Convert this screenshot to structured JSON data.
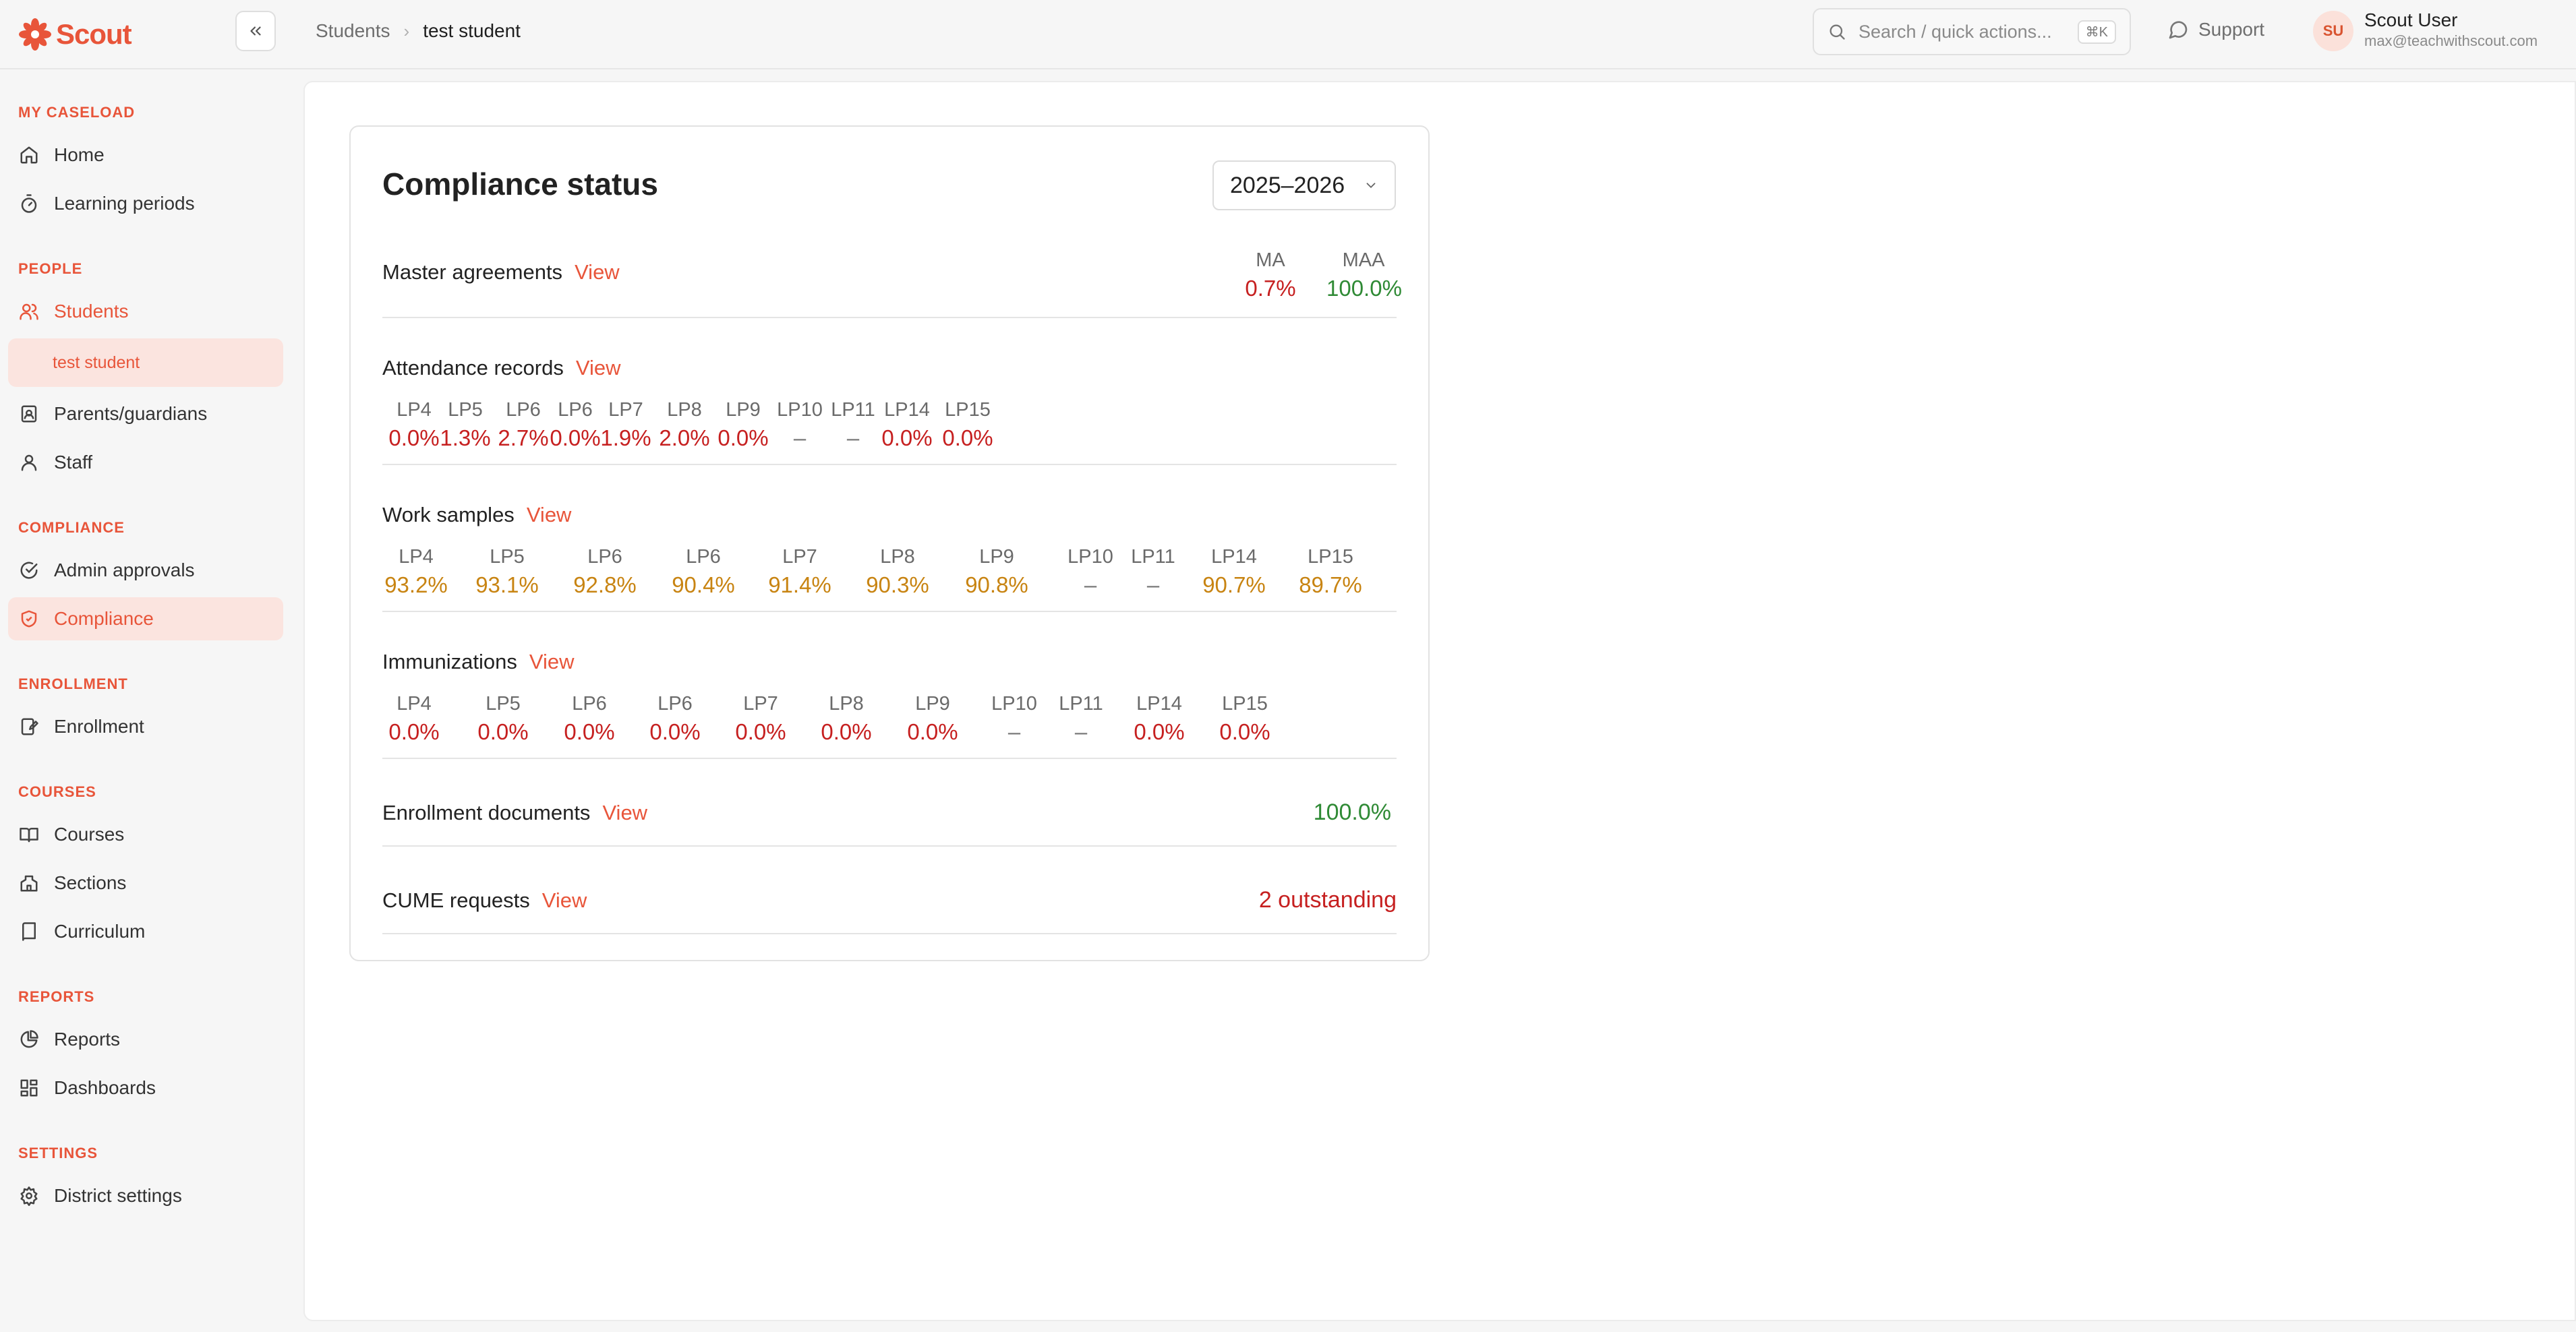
{
  "app": {
    "name": "Scout",
    "brand_color": "#e8553a"
  },
  "breadcrumb": {
    "parent": "Students",
    "current": "test student"
  },
  "search": {
    "placeholder": "Search / quick actions...",
    "shortcut": "⌘K"
  },
  "support": {
    "label": "Support"
  },
  "user": {
    "initials": "SU",
    "name": "Scout User",
    "email": "max@teachwithscout.com"
  },
  "sidebar": {
    "sections": {
      "caseload": "MY CASELOAD",
      "people": "PEOPLE",
      "compliance": "COMPLIANCE",
      "enrollment": "ENROLLMENT",
      "courses": "COURSES",
      "reports": "REPORTS",
      "settings": "SETTINGS"
    },
    "items": {
      "home": "Home",
      "learning_periods": "Learning periods",
      "students": "Students",
      "test_student": "test student",
      "parents": "Parents/guardians",
      "staff": "Staff",
      "admin_approvals": "Admin approvals",
      "compliance": "Compliance",
      "enrollment": "Enrollment",
      "courses": "Courses",
      "sections": "Sections",
      "curriculum": "Curriculum",
      "reports": "Reports",
      "dashboards": "Dashboards",
      "district_settings": "District settings"
    }
  },
  "compliance": {
    "title": "Compliance status",
    "year": "2025–2026",
    "view_label": "View",
    "master_agreements": {
      "label": "Master agreements",
      "cols": [
        {
          "h": "MA",
          "v": "0.7%",
          "status": "red"
        },
        {
          "h": "MAA",
          "v": "100.0%",
          "status": "green"
        }
      ]
    },
    "attendance": {
      "label": "Attendance records",
      "cols": [
        {
          "h": "LP4",
          "v": "0.0%"
        },
        {
          "h": "LP5",
          "v": "1.3%"
        },
        {
          "h": "LP6",
          "v": "2.7%"
        },
        {
          "h": "LP6",
          "v": "0.0%"
        },
        {
          "h": "LP7",
          "v": "1.9%"
        },
        {
          "h": "LP8",
          "v": "2.0%"
        },
        {
          "h": "LP9",
          "v": "0.0%"
        },
        {
          "h": "LP10",
          "v": "–"
        },
        {
          "h": "LP11",
          "v": "–"
        },
        {
          "h": "LP14",
          "v": "0.0%"
        },
        {
          "h": "LP15",
          "v": "0.0%"
        }
      ]
    },
    "work_samples": {
      "label": "Work samples",
      "cols": [
        {
          "h": "LP4",
          "v": "93.2%"
        },
        {
          "h": "LP5",
          "v": "93.1%"
        },
        {
          "h": "LP6",
          "v": "92.8%"
        },
        {
          "h": "LP6",
          "v": "90.4%"
        },
        {
          "h": "LP7",
          "v": "91.4%"
        },
        {
          "h": "LP8",
          "v": "90.3%"
        },
        {
          "h": "LP9",
          "v": "90.8%"
        },
        {
          "h": "LP10",
          "v": "–"
        },
        {
          "h": "LP11",
          "v": "–"
        },
        {
          "h": "LP14",
          "v": "90.7%"
        },
        {
          "h": "LP15",
          "v": "89.7%"
        }
      ]
    },
    "immunizations": {
      "label": "Immunizations",
      "cols": [
        {
          "h": "LP4",
          "v": "0.0%"
        },
        {
          "h": "LP5",
          "v": "0.0%"
        },
        {
          "h": "LP6",
          "v": "0.0%"
        },
        {
          "h": "LP6",
          "v": "0.0%"
        },
        {
          "h": "LP7",
          "v": "0.0%"
        },
        {
          "h": "LP8",
          "v": "0.0%"
        },
        {
          "h": "LP9",
          "v": "0.0%"
        },
        {
          "h": "LP10",
          "v": "–"
        },
        {
          "h": "LP11",
          "v": "–"
        },
        {
          "h": "LP14",
          "v": "0.0%"
        },
        {
          "h": "LP15",
          "v": "0.0%"
        }
      ]
    },
    "enrollment_documents": {
      "label": "Enrollment documents",
      "value": "100.0%"
    },
    "cume_requests": {
      "label": "CUME requests",
      "value": "2 outstanding"
    }
  }
}
